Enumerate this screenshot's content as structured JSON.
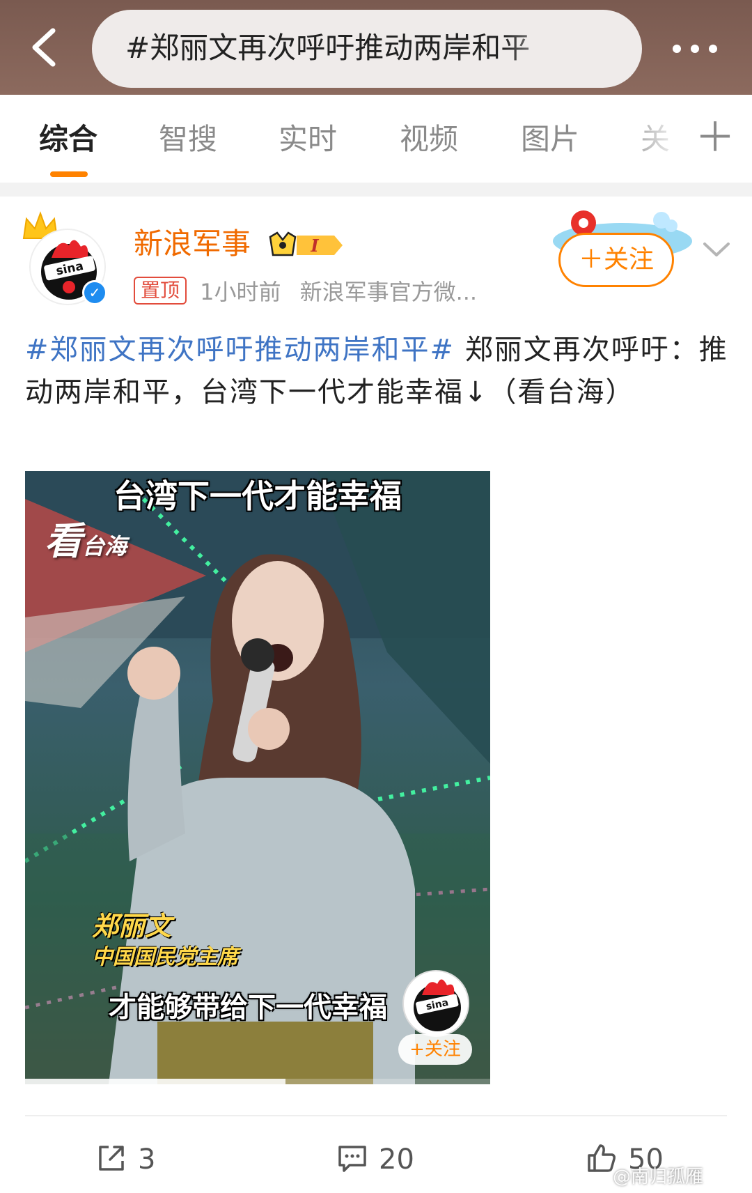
{
  "search": {
    "query": "#郑丽文再次呼吁推动两岸和平"
  },
  "tabs": [
    {
      "label": "综合"
    },
    {
      "label": "智搜"
    },
    {
      "label": "实时"
    },
    {
      "label": "视频"
    },
    {
      "label": "图片"
    },
    {
      "label": "关"
    }
  ],
  "tab_add": "＋",
  "post": {
    "author": "新浪军事",
    "vip_level": "I",
    "pin_label": "置顶",
    "time": "1小时前",
    "source": "新浪军事官方微...",
    "follow_label": "＋关注",
    "hashtag": "#郑丽文再次呼吁推动两岸和平#",
    "body": " 郑丽文再次呼吁：推动两岸和平，台湾下一代才能幸福↓（看台海）",
    "video": {
      "caption_top": "台湾下一代才能幸福",
      "watermark_main": "看",
      "watermark_sub": "台海",
      "person_name": "郑丽文",
      "person_role": "中国国民党主席",
      "subtitle": "才能够带给下一代幸福",
      "logo_text": "sina",
      "follow_label": "+关注",
      "progress": 0.56
    },
    "actions": {
      "share_count": "3",
      "comment_count": "20",
      "like_count": "50"
    }
  },
  "page_watermark": "@南归孤雁",
  "colors": {
    "accent": "#ff8200",
    "hashtag": "#3f74c4",
    "author": "#f06a00",
    "pin": "#e24c3c",
    "topbar": "#84645a"
  }
}
